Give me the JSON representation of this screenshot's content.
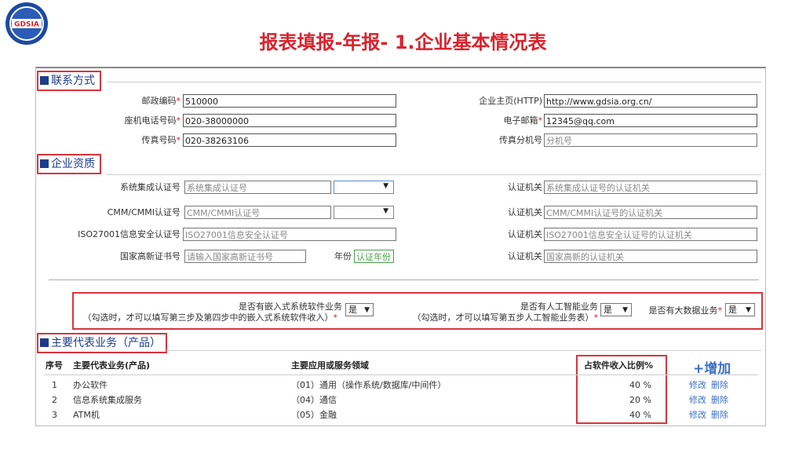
{
  "header": {
    "logo_text": "GDSIA",
    "title": "报表填报-年报- 1.企业基本情况表"
  },
  "contact": {
    "section_title": "联系方式",
    "postal_label": "邮政编码",
    "postal_value": "510000",
    "phone_label": "座机电话号码",
    "phone_value": "020-38000000",
    "fax_label": "传真号码",
    "fax_value": "020-38263106",
    "homepage_label": "企业主页(HTTP)",
    "homepage_value": "http://www.gdsia.org.cn/",
    "email_label": "电子邮箱",
    "email_value": "12345@qq.com",
    "fax_ext_label": "传真分机号",
    "fax_ext_placeholder": "分机号"
  },
  "qualification": {
    "section_title": "企业资质",
    "si_label": "系统集成认证号",
    "si_placeholder": "系统集成认证号",
    "cmm_label": "CMM/CMMI认证号",
    "cmm_placeholder": "CMM/CMMI认证号",
    "iso_label": "ISO27001信息安全认证号",
    "iso_placeholder": "ISO27001信息安全认证号",
    "hightech_label": "国家高新证书号",
    "hightech_placeholder": "请输入国家高新证书号",
    "year_label": "年份",
    "year_placeholder": "认证年份",
    "authority_label": "认证机关",
    "si_auth_placeholder": "系统集成认证号的认证机关",
    "cmm_auth_placeholder": "CMM/CMMI认证号的认证机关",
    "iso_auth_placeholder": "ISO27001信息安全认证号的认证机关",
    "hightech_auth_placeholder": "国家高新的认证机关"
  },
  "questions": {
    "embedded_q": "是否有嵌入式系统软件业务",
    "embedded_note": "（勾选时，才可以填写第三步及第四步中的嵌入式系统软件收入）",
    "embedded_value": "是",
    "ai_q": "是否有人工智能业务",
    "ai_note": "（勾选时，才可以填写第五步人工智能业务表）",
    "ai_value": "是",
    "bigdata_q": "是否有大数据业务",
    "bigdata_value": "是"
  },
  "business": {
    "section_title": "主要代表业务（产品）",
    "col_no": "序号",
    "col_business": "主要代表业务(产品)",
    "col_field": "主要应用或服务领域",
    "col_ratio": "占软件收入比例%",
    "add_label": "+增加",
    "edit_label": "修改",
    "delete_label": "删除",
    "rows": [
      {
        "no": "1",
        "name": "办公软件",
        "field": "（01）通用（操作系统/数据库/中间件）",
        "ratio": "40 %"
      },
      {
        "no": "2",
        "name": "信息系统集成服务",
        "field": "（04）通信",
        "ratio": "20 %"
      },
      {
        "no": "3",
        "name": "ATM机",
        "field": "（05）金融",
        "ratio": "40 %"
      }
    ]
  },
  "colors": {
    "title_red": "#d9232d",
    "section_blue": "#1a3c8c",
    "highlight_red": "#d9343d",
    "link_blue": "#3a70c8"
  }
}
